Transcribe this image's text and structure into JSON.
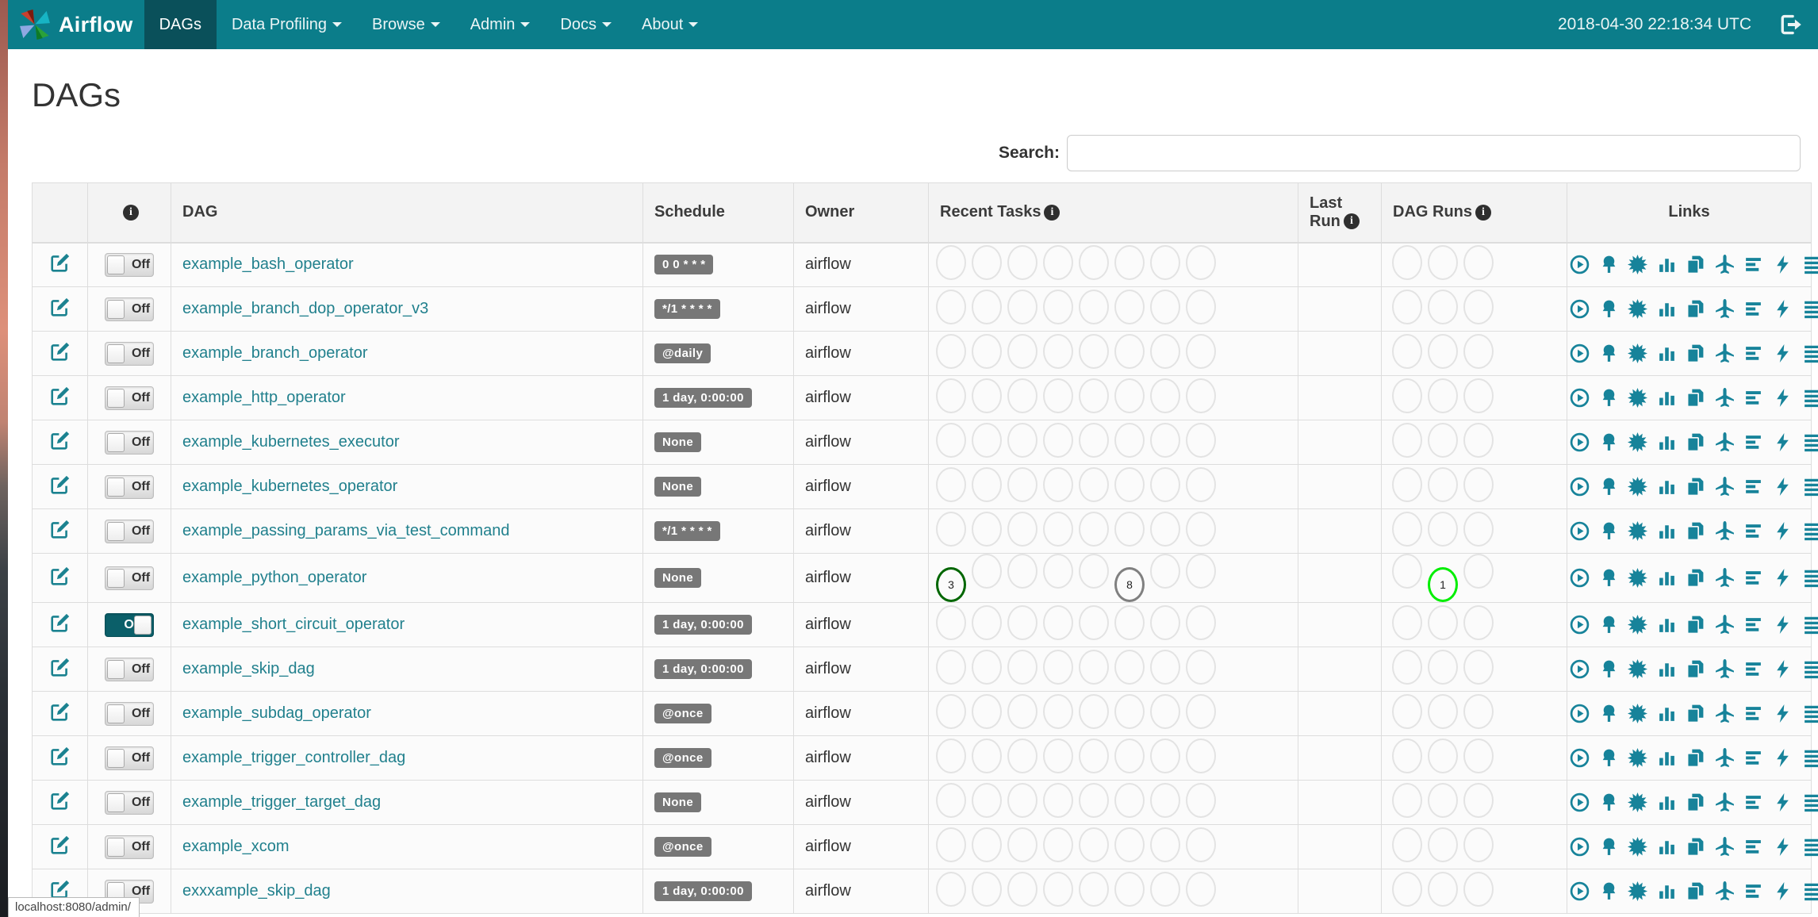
{
  "navbar": {
    "brand": "Airflow",
    "items": [
      {
        "label": "DAGs",
        "active": true,
        "dropdown": false
      },
      {
        "label": "Data Profiling",
        "active": false,
        "dropdown": true
      },
      {
        "label": "Browse",
        "active": false,
        "dropdown": true
      },
      {
        "label": "Admin",
        "active": false,
        "dropdown": true
      },
      {
        "label": "Docs",
        "active": false,
        "dropdown": true
      },
      {
        "label": "About",
        "active": false,
        "dropdown": true
      }
    ],
    "clock": "2018-04-30 22:18:34 UTC"
  },
  "page": {
    "title": "DAGs",
    "search_label": "Search:",
    "search_value": ""
  },
  "table": {
    "headers": {
      "info_glyph": "i",
      "dag": "DAG",
      "schedule": "Schedule",
      "owner": "Owner",
      "recent_tasks": "Recent Tasks",
      "last_run": "Last Run",
      "dag_runs": "DAG Runs",
      "links": "Links"
    },
    "toggle": {
      "on_label": "On",
      "off_label": "Off"
    },
    "status_colors": {
      "success": "#006600",
      "queued": "#808080",
      "running": "#00ee00",
      "none": "#e3e3e3"
    },
    "links_icons": [
      "trigger-dag-icon",
      "tree-view-icon",
      "graph-view-icon",
      "task-duration-icon",
      "task-tries-icon",
      "landing-times-icon",
      "gantt-view-icon",
      "code-view-icon",
      "logs-icon",
      "refresh-icon"
    ],
    "rows": [
      {
        "name": "example_bash_operator",
        "paused": true,
        "schedule": "0 0 * * *",
        "owner": "airflow",
        "recent_tasks": [
          null,
          null,
          null,
          null,
          null,
          null,
          null,
          null
        ],
        "last_run": "",
        "dag_runs": [
          null,
          null,
          null
        ]
      },
      {
        "name": "example_branch_dop_operator_v3",
        "paused": true,
        "schedule": "*/1 * * * *",
        "owner": "airflow",
        "recent_tasks": [
          null,
          null,
          null,
          null,
          null,
          null,
          null,
          null
        ],
        "last_run": "",
        "dag_runs": [
          null,
          null,
          null
        ]
      },
      {
        "name": "example_branch_operator",
        "paused": true,
        "schedule": "@daily",
        "owner": "airflow",
        "recent_tasks": [
          null,
          null,
          null,
          null,
          null,
          null,
          null,
          null
        ],
        "last_run": "",
        "dag_runs": [
          null,
          null,
          null
        ]
      },
      {
        "name": "example_http_operator",
        "paused": true,
        "schedule": "1 day, 0:00:00",
        "owner": "airflow",
        "recent_tasks": [
          null,
          null,
          null,
          null,
          null,
          null,
          null,
          null
        ],
        "last_run": "",
        "dag_runs": [
          null,
          null,
          null
        ]
      },
      {
        "name": "example_kubernetes_executor",
        "paused": true,
        "schedule": "None",
        "owner": "airflow",
        "recent_tasks": [
          null,
          null,
          null,
          null,
          null,
          null,
          null,
          null
        ],
        "last_run": "",
        "dag_runs": [
          null,
          null,
          null
        ]
      },
      {
        "name": "example_kubernetes_operator",
        "paused": true,
        "schedule": "None",
        "owner": "airflow",
        "recent_tasks": [
          null,
          null,
          null,
          null,
          null,
          null,
          null,
          null
        ],
        "last_run": "",
        "dag_runs": [
          null,
          null,
          null
        ]
      },
      {
        "name": "example_passing_params_via_test_command",
        "paused": true,
        "schedule": "*/1 * * * *",
        "owner": "airflow",
        "recent_tasks": [
          null,
          null,
          null,
          null,
          null,
          null,
          null,
          null
        ],
        "last_run": "",
        "dag_runs": [
          null,
          null,
          null
        ]
      },
      {
        "name": "example_python_operator",
        "paused": true,
        "schedule": "None",
        "owner": "airflow",
        "recent_tasks": [
          {
            "count": 3,
            "state": "success"
          },
          null,
          null,
          null,
          null,
          {
            "count": 8,
            "state": "queued"
          },
          null,
          null
        ],
        "last_run": "",
        "dag_runs": [
          null,
          {
            "count": 1,
            "state": "running"
          },
          null
        ]
      },
      {
        "name": "example_short_circuit_operator",
        "paused": false,
        "schedule": "1 day, 0:00:00",
        "owner": "airflow",
        "recent_tasks": [
          null,
          null,
          null,
          null,
          null,
          null,
          null,
          null
        ],
        "last_run": "",
        "dag_runs": [
          null,
          null,
          null
        ]
      },
      {
        "name": "example_skip_dag",
        "paused": true,
        "schedule": "1 day, 0:00:00",
        "owner": "airflow",
        "recent_tasks": [
          null,
          null,
          null,
          null,
          null,
          null,
          null,
          null
        ],
        "last_run": "",
        "dag_runs": [
          null,
          null,
          null
        ]
      },
      {
        "name": "example_subdag_operator",
        "paused": true,
        "schedule": "@once",
        "owner": "airflow",
        "recent_tasks": [
          null,
          null,
          null,
          null,
          null,
          null,
          null,
          null
        ],
        "last_run": "",
        "dag_runs": [
          null,
          null,
          null
        ]
      },
      {
        "name": "example_trigger_controller_dag",
        "paused": true,
        "schedule": "@once",
        "owner": "airflow",
        "recent_tasks": [
          null,
          null,
          null,
          null,
          null,
          null,
          null,
          null
        ],
        "last_run": "",
        "dag_runs": [
          null,
          null,
          null
        ]
      },
      {
        "name": "example_trigger_target_dag",
        "paused": true,
        "schedule": "None",
        "owner": "airflow",
        "recent_tasks": [
          null,
          null,
          null,
          null,
          null,
          null,
          null,
          null
        ],
        "last_run": "",
        "dag_runs": [
          null,
          null,
          null
        ]
      },
      {
        "name": "example_xcom",
        "paused": true,
        "schedule": "@once",
        "owner": "airflow",
        "recent_tasks": [
          null,
          null,
          null,
          null,
          null,
          null,
          null,
          null
        ],
        "last_run": "",
        "dag_runs": [
          null,
          null,
          null
        ]
      },
      {
        "name": "exxxample_skip_dag",
        "paused": true,
        "schedule": "1 day, 0:00:00",
        "owner": "airflow",
        "recent_tasks": [
          null,
          null,
          null,
          null,
          null,
          null,
          null,
          null
        ],
        "last_run": "",
        "dag_runs": [
          null,
          null,
          null
        ]
      }
    ]
  },
  "browser": {
    "status_bar": "localhost:8080/admin/"
  }
}
